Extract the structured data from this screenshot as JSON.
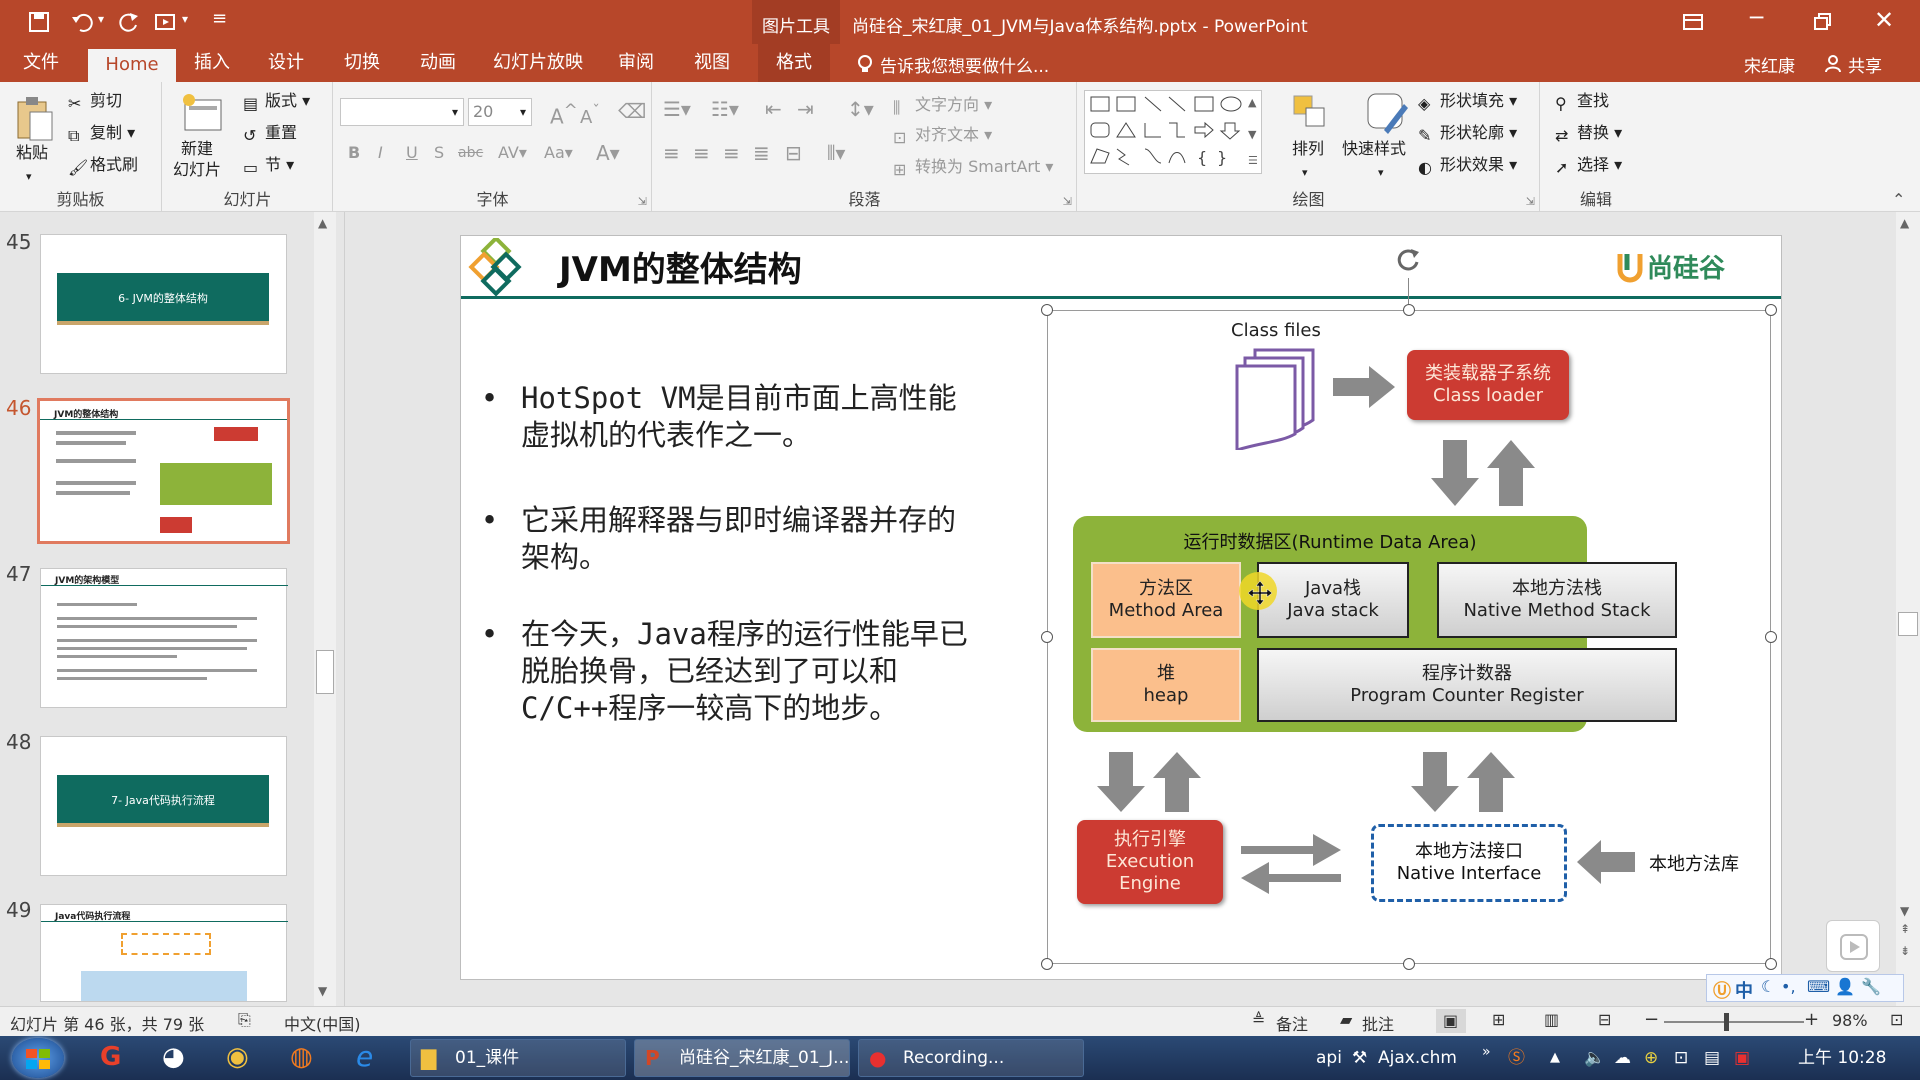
{
  "window": {
    "title": "尚硅谷_宋红康_01_JVM与Java体系结构.pptx - PowerPoint",
    "context_tab": "图片工具"
  },
  "tabs": [
    "文件",
    "Home",
    "插入",
    "设计",
    "切换",
    "动画",
    "幻灯片放映",
    "审阅",
    "视图",
    "格式"
  ],
  "tell_me": "告诉我您想要做什么...",
  "user": {
    "name": "宋红康",
    "share": "共享"
  },
  "ribbon": {
    "clipboard": {
      "label": "剪贴板",
      "paste": "粘贴",
      "cut": "剪切",
      "copy": "复制",
      "format_painter": "格式刷"
    },
    "slides": {
      "label": "幻灯片",
      "new_slide": "新建\n幻灯片",
      "layout": "版式",
      "reset": "重置",
      "section": "节"
    },
    "font": {
      "label": "字体",
      "font_name": "",
      "font_size": "20"
    },
    "paragraph": {
      "label": "段落",
      "text_direction": "文字方向",
      "align_text": "对齐文本",
      "smartart": "转换为 SmartArt"
    },
    "drawing": {
      "label": "绘图",
      "arrange": "排列",
      "quick_styles": "快速样式",
      "shape_fill": "形状填充",
      "shape_outline": "形状轮廓",
      "shape_effects": "形状效果"
    },
    "editing": {
      "label": "编辑",
      "find": "查找",
      "replace": "替换",
      "select": "选择"
    }
  },
  "thumbnails": [
    {
      "num": "45",
      "title": "6- JVM的整体结构"
    },
    {
      "num": "46",
      "title": "JVM的整体结构"
    },
    {
      "num": "47",
      "title": "JVM的架构模型"
    },
    {
      "num": "48",
      "title": "7- Java代码执行流程"
    },
    {
      "num": "49",
      "title": "Java代码执行流程"
    }
  ],
  "slide": {
    "title": "JVM的整体结构",
    "logo": "尚硅谷",
    "bullets": [
      "HotSpot VM是目前市面上高性能虚拟机的代表作之一。",
      "它采用解释器与即时编译器并存的架构。",
      "在今天，Java程序的运行性能早已脱胎换骨，已经达到了可以和C/C++程序一较高下的地步。"
    ],
    "diagram": {
      "class_files": "Class files",
      "class_loader_cn": "类装载器子系统",
      "class_loader_en": "Class loader",
      "runtime_area": "运行时数据区(Runtime Data Area)",
      "method_area_cn": "方法区",
      "method_area_en": "Method Area",
      "java_stack_cn": "Java栈",
      "java_stack_en": "Java stack",
      "native_stack_cn": "本地方法栈",
      "native_stack_en": "Native Method Stack",
      "heap_cn": "堆",
      "heap_en": "heap",
      "pc_cn": "程序计数器",
      "pc_en": "Program Counter Register",
      "engine_cn": "执行引擎",
      "engine_en1": "Execution",
      "engine_en2": "Engine",
      "native_if_cn": "本地方法接口",
      "native_if_en": "Native Interface",
      "native_lib": "本地方法库"
    }
  },
  "status": {
    "slide_info": "幻灯片 第 46 张，共 79 张",
    "language": "中文(中国)",
    "notes": "备注",
    "comments": "批注",
    "zoom": "98%"
  },
  "taskbar": {
    "items": [
      "01_课件",
      "尚硅谷_宋红康_01_J...",
      "Recording..."
    ],
    "tray_api": "api",
    "tray_file": "Ajax.chm",
    "clock": "上午 10:28"
  },
  "ime": "中",
  "colors": {
    "accent": "#b7472a",
    "teal": "#0f6b5f",
    "green": "#8db33a",
    "red": "#cc3b32",
    "orange": "#fbbf8c"
  }
}
